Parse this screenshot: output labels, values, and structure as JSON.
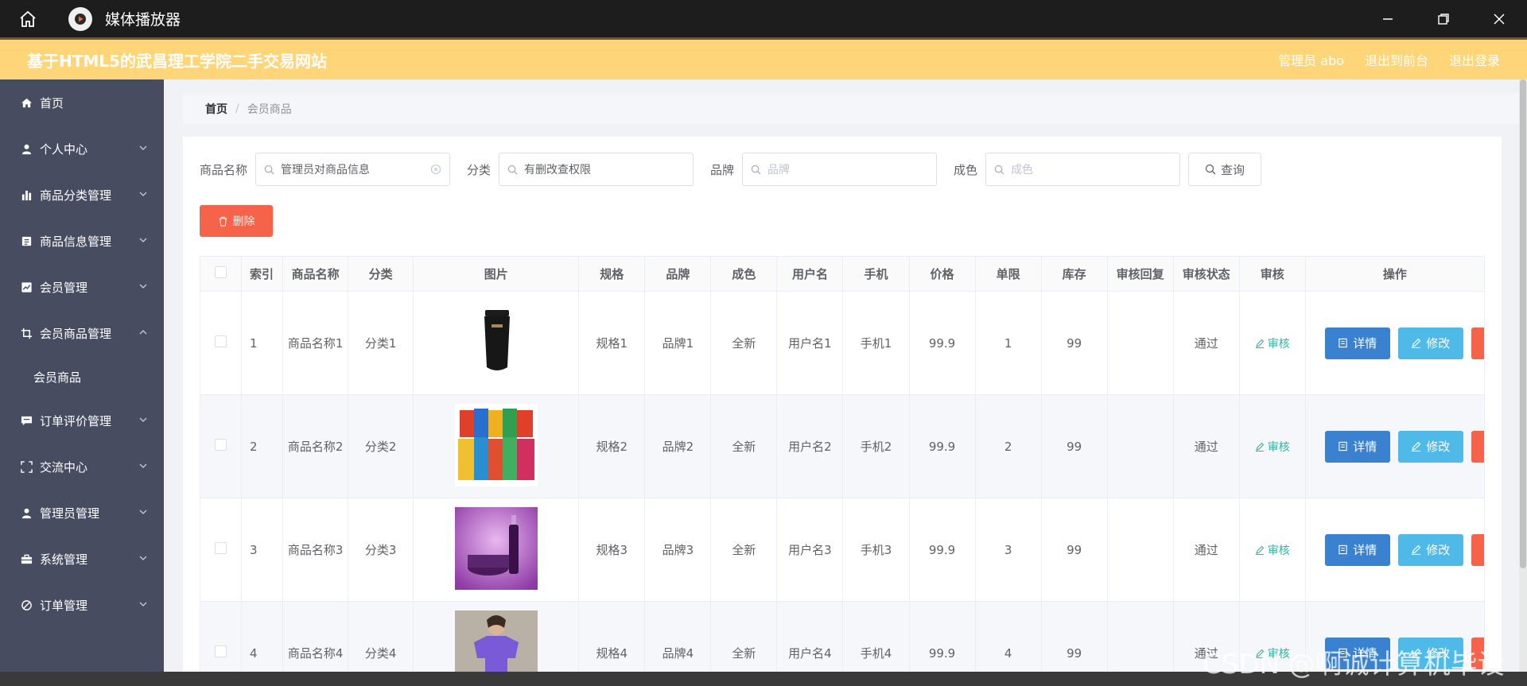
{
  "window": {
    "title": "媒体播放器"
  },
  "header": {
    "site_title": "基于HTML5的武昌理工学院二手交易网站",
    "links": [
      "管理员 abo",
      "退出到前台",
      "退出登录"
    ]
  },
  "sidebar": {
    "items": [
      {
        "label": "首页",
        "icon": "home-icon"
      },
      {
        "label": "个人中心",
        "icon": "user-icon"
      },
      {
        "label": "商品分类管理",
        "icon": "bar-chart-icon"
      },
      {
        "label": "商品信息管理",
        "icon": "trash-icon"
      },
      {
        "label": "会员管理",
        "icon": "chart-icon"
      },
      {
        "label": "会员商品管理",
        "icon": "crop-icon"
      },
      {
        "label": "订单评价管理",
        "icon": "comment-icon"
      },
      {
        "label": "交流中心",
        "icon": "fullscreen-icon"
      },
      {
        "label": "管理员管理",
        "icon": "user-icon"
      },
      {
        "label": "系统管理",
        "icon": "briefcase-icon"
      },
      {
        "label": "订单管理",
        "icon": "no-icon"
      }
    ],
    "sub_item": "会员商品"
  },
  "breadcrumb": {
    "home": "首页",
    "sep": "/",
    "current": "会员商品"
  },
  "search": {
    "name_label": "商品名称",
    "name_value": "管理员对商品信息",
    "category_label": "分类",
    "category_value": "有删改查权限",
    "brand_label": "品牌",
    "brand_placeholder": "品牌",
    "condition_label": "成色",
    "condition_placeholder": "成色",
    "query_button": "查询"
  },
  "delete_button": "删除",
  "table": {
    "headers": [
      "索引",
      "商品名称",
      "分类",
      "图片",
      "规格",
      "品牌",
      "成色",
      "用户名",
      "手机",
      "价格",
      "单限",
      "库存",
      "审核回复",
      "审核状态",
      "审核",
      "操作"
    ],
    "audit_link": "审核",
    "detail_button": "详情",
    "edit_button": "修改",
    "rows": [
      {
        "index": "1",
        "name": "商品名称1",
        "category": "分类1",
        "spec": "规格1",
        "brand": "品牌1",
        "condition": "全新",
        "username": "用户名1",
        "phone": "手机1",
        "price": "99.9",
        "limit": "1",
        "stock": "99",
        "reply": "",
        "status": "通过"
      },
      {
        "index": "2",
        "name": "商品名称2",
        "category": "分类2",
        "spec": "规格2",
        "brand": "品牌2",
        "condition": "全新",
        "username": "用户名2",
        "phone": "手机2",
        "price": "99.9",
        "limit": "2",
        "stock": "99",
        "reply": "",
        "status": "通过"
      },
      {
        "index": "3",
        "name": "商品名称3",
        "category": "分类3",
        "spec": "规格3",
        "brand": "品牌3",
        "condition": "全新",
        "username": "用户名3",
        "phone": "手机3",
        "price": "99.9",
        "limit": "3",
        "stock": "99",
        "reply": "",
        "status": "通过"
      },
      {
        "index": "4",
        "name": "商品名称4",
        "category": "分类4",
        "spec": "规格4",
        "brand": "品牌4",
        "condition": "全新",
        "username": "用户名4",
        "phone": "手机4",
        "price": "99.9",
        "limit": "4",
        "stock": "99",
        "reply": "",
        "status": "通过"
      }
    ]
  },
  "watermark": "CSDN @啊诚计算机毕设",
  "colors": {
    "header_bg": "#ffd57a",
    "sidebar_bg": "#484c61",
    "delete_red": "#f5634a",
    "detail_blue": "#3a82cf",
    "edit_blue": "#4fb9e8",
    "audit_green": "#2db7a3"
  }
}
